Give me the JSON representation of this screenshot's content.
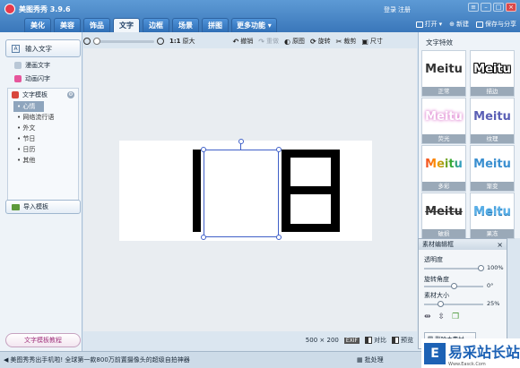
{
  "app": {
    "title": "美图秀秀 3.9.6",
    "login": "登录",
    "register": "注册"
  },
  "tabs": [
    {
      "label": "美化"
    },
    {
      "label": "美容"
    },
    {
      "label": "饰品"
    },
    {
      "label": "文字",
      "active": true
    },
    {
      "label": "边框"
    },
    {
      "label": "场景"
    },
    {
      "label": "拼图"
    },
    {
      "label": "更多功能"
    }
  ],
  "top_actions": {
    "open": "打开",
    "new": "新建",
    "save_share": "保存与分享"
  },
  "left_panel": {
    "input_text": "输入文字",
    "comic_text": "漫画文字",
    "animated_text": "动画闪字",
    "templates_title": "文字模板",
    "template_categories": [
      "心情",
      "网络流行语",
      "外文",
      "节日",
      "日历",
      "其他"
    ],
    "selected_category": "心情",
    "import_template": "导入模板",
    "tutorial": "文字模板教程"
  },
  "toolbar": {
    "zoom_ratio": "1:1",
    "original_size": "原大",
    "undo": "撤销",
    "redo": "重做",
    "original_image": "原图",
    "rotate": "旋转",
    "crop": "裁剪",
    "resize": "尺寸"
  },
  "canvas": {
    "width": "500",
    "height": "200",
    "exif": "EXIF",
    "compare": "对比",
    "preview": "预览"
  },
  "effects_panel": {
    "title": "文字特效",
    "items": [
      {
        "preview_text": "Meitu",
        "label": "正常",
        "style": "normal"
      },
      {
        "preview_text": "Meitu",
        "label": "描边",
        "style": "stroke"
      },
      {
        "preview_text": "Meitu",
        "label": "荧光",
        "style": "glow"
      },
      {
        "preview_text": "Meitu",
        "label": "纹理",
        "style": "texture"
      },
      {
        "preview_text": "Meitu",
        "label": "多彩",
        "style": "colorful"
      },
      {
        "preview_text": "Meitu",
        "label": "渐变",
        "style": "gradient"
      },
      {
        "preview_text": "Meitu",
        "label": "破损",
        "style": "broken"
      },
      {
        "preview_text": "Meitu",
        "label": "果冻",
        "style": "jelly"
      }
    ]
  },
  "material_editor": {
    "title": "素材编辑框",
    "opacity_label": "透明度",
    "opacity_value": "100%",
    "opacity": 1.0,
    "rotation_label": "旋转角度",
    "rotation_value": "0°",
    "rotation": 0.5,
    "size_label": "素材大小",
    "size_value": "25%",
    "size": 0.25,
    "delete_label": "删除本素材"
  },
  "bottom_bar": {
    "tip": "美图秀秀出手机啦! 全球第一款800万前置摄像头的超级自拍神器",
    "process": "批处理",
    "watermark_cn": "易采站长站",
    "watermark_en": "Www.Easck.Com"
  },
  "colors": {
    "accent": "#3a77ba",
    "active_tab": "#f2f6fa",
    "selection": "#4060c8",
    "effect_label_bg": "#9aa9b8"
  }
}
